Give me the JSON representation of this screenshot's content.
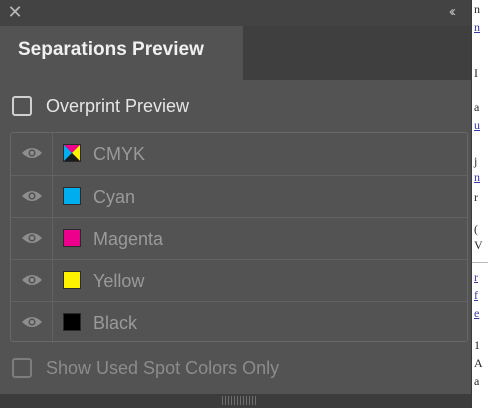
{
  "panel": {
    "tab_label": "Separations Preview",
    "close_icon": "✕",
    "collapse_icon": "‹‹"
  },
  "overprint": {
    "label": "Overprint Preview",
    "checked": false
  },
  "separations": [
    {
      "label": "CMYK",
      "swatch": "cmyk",
      "visible": true
    },
    {
      "label": "Cyan",
      "swatch": "#00AEEF",
      "visible": true
    },
    {
      "label": "Magenta",
      "swatch": "#EC008C",
      "visible": true
    },
    {
      "label": "Yellow",
      "swatch": "#FFF200",
      "visible": true
    },
    {
      "label": "Black",
      "swatch": "#000000",
      "visible": true
    }
  ],
  "spot_only": {
    "label": "Show Used Spot Colors Only",
    "checked": false
  },
  "colors": {
    "panel_bg": "#535353",
    "tab_strip_bg": "#3F3F3F",
    "text_primary": "#E6E6E6",
    "text_disabled": "#9A9A9A"
  }
}
